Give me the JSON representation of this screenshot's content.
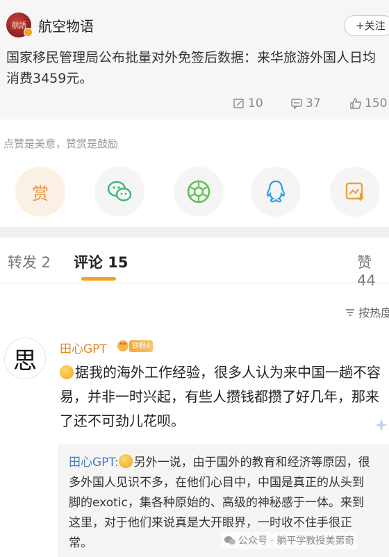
{
  "post": {
    "author_avatar_text": "航語",
    "author": "航空物语",
    "follow_label": "+关注",
    "text": "国家移民管理局公布批量对外免签后数据：来华旅游外国人日均消费3459元。",
    "stats": {
      "reposts": "10",
      "comments": "37",
      "likes": "150"
    }
  },
  "reward": {
    "hint": "点赞是美意，赞赏是鼓励",
    "reward_label": "赏",
    "share_icons": [
      "reward-icon",
      "wechat-icon",
      "moments-icon",
      "qq-icon",
      "save-image-icon"
    ]
  },
  "tabs": [
    {
      "label": "转发 2"
    },
    {
      "label": "评论 15"
    },
    {
      "label": "赞 44"
    }
  ],
  "sort_label": "按热度",
  "comment": {
    "avatar_text": "思",
    "author": "田心GPT",
    "level_badge": "铁粉4",
    "text": "据我的海外工作经验，很多人认为来中国一趟不容易，并非一时兴起，有些人攒钱都攒了好几年，那来了还不可劲儿花呗。",
    "reply": {
      "author": "田心GPT:",
      "text": "另外一说，由于国外的教育和经济等原因，很多外国人见识不多，在他们心目中，中国是真正的从头到脚的exotic，集各种原始的、高级的神秘感于一体。来到这里，对于他们来说真是大开眼界，一时收不住手很正常。"
    }
  },
  "watermark": "公众号 · 躺平学教授美第奇",
  "colors": {
    "accent": "#f2a41c",
    "name_orange": "#e08a2a",
    "reply_name": "#4a7bbf"
  }
}
